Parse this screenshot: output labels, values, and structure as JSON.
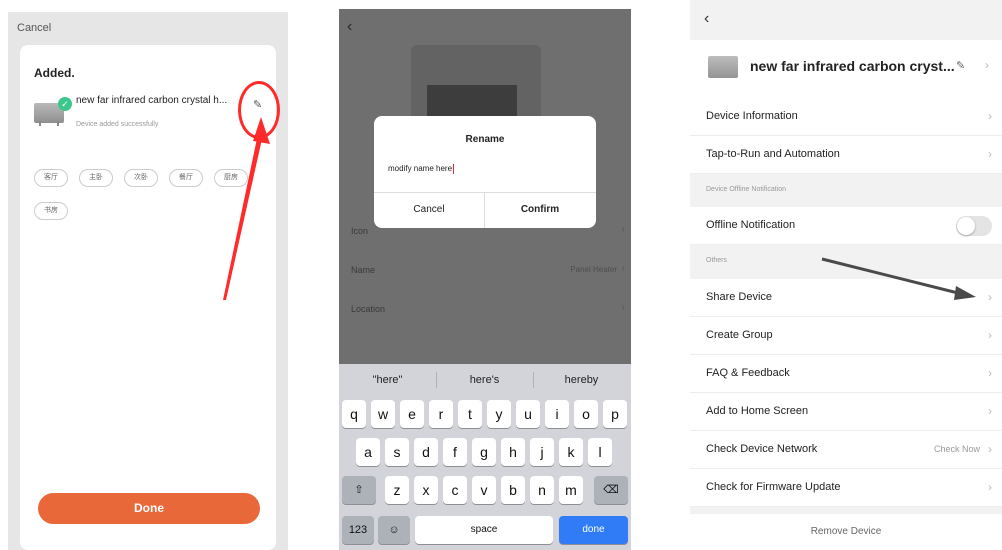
{
  "panel1": {
    "cancel_label": "Cancel",
    "added_title": "Added.",
    "device_name": "new far infrared carbon crystal h...",
    "device_status": "Device added successfully",
    "room_chips": [
      "客厅",
      "主卧",
      "次卧",
      "餐厅",
      "厨房",
      "书房"
    ],
    "done_label": "Done",
    "accent_color": "#e8683a",
    "annotation_color": "#ff2a2a"
  },
  "panel2": {
    "dialog": {
      "title": "Rename",
      "input_value": "modify name here",
      "cancel_label": "Cancel",
      "confirm_label": "Confirm"
    },
    "rows": {
      "icon_label": "Icon",
      "name_label": "Name",
      "name_value": "Panel Heater",
      "location_label": "Location"
    },
    "keyboard": {
      "suggestions": [
        "\"here\"",
        "here's",
        "hereby"
      ],
      "row1": [
        "q",
        "w",
        "e",
        "r",
        "t",
        "y",
        "u",
        "i",
        "o",
        "p"
      ],
      "row2": [
        "a",
        "s",
        "d",
        "f",
        "g",
        "h",
        "j",
        "k",
        "l"
      ],
      "row3": [
        "z",
        "x",
        "c",
        "v",
        "b",
        "n",
        "m"
      ],
      "shift": "⇧",
      "backspace": "⌫",
      "numbers": "123",
      "emoji": "☺",
      "space": "space",
      "done": "done"
    }
  },
  "panel3": {
    "device_name": "new far infrared carbon cryst...",
    "items": {
      "device_information": "Device Information",
      "tap_to_run": "Tap-to-Run and Automation",
      "offline_section": "Device Offline Notification",
      "offline_notification": "Offline Notification",
      "others_section": "Others",
      "share_device": "Share Device",
      "create_group": "Create Group",
      "faq": "FAQ & Feedback",
      "add_home": "Add to Home Screen",
      "check_network": "Check Device Network",
      "check_network_value": "Check Now",
      "firmware": "Check for Firmware Update"
    },
    "offline_toggle_on": false,
    "remove_label": "Remove Device"
  }
}
